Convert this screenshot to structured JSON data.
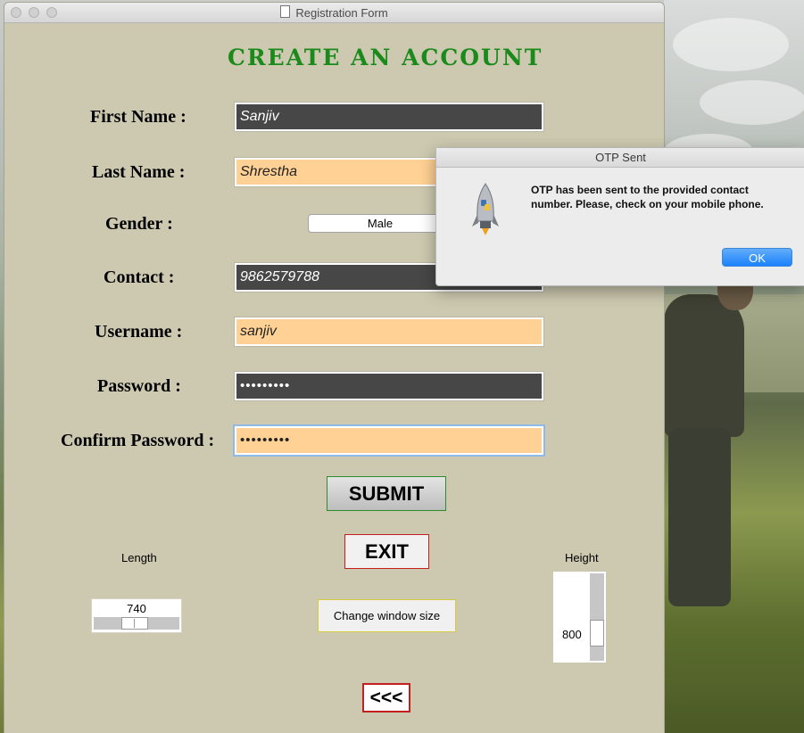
{
  "window": {
    "title": "Registration Form"
  },
  "form": {
    "heading": "CREATE AN ACCOUNT",
    "labels": {
      "first_name": "First Name :",
      "last_name": "Last Name :",
      "gender": "Gender :",
      "contact": "Contact :",
      "username": "Username :",
      "password": "Password :",
      "confirm_password": "Confirm Password :"
    },
    "values": {
      "first_name": "Sanjiv",
      "last_name": "Shrestha",
      "gender": "Male",
      "contact": "9862579788",
      "username": "sanjiv",
      "password": "•••••••••",
      "confirm_password": "•••••••••"
    },
    "buttons": {
      "submit": "SUBMIT",
      "exit": "EXIT",
      "change_size": "Change window size",
      "back": "<<<"
    },
    "length": {
      "label": "Length",
      "value": "740"
    },
    "height": {
      "label": "Height",
      "value": "800"
    }
  },
  "dialog": {
    "title": "OTP Sent",
    "message": "OTP has been sent to the provided contact number. Please, check on your mobile phone.",
    "ok": "OK",
    "icon": "python-rocket-icon"
  },
  "colors": {
    "window_bg": "#cdc9b0",
    "heading": "#1a8a1a",
    "dark_field": "#474747",
    "light_field": "#ffd194",
    "ok_button": "#1a82fb"
  }
}
